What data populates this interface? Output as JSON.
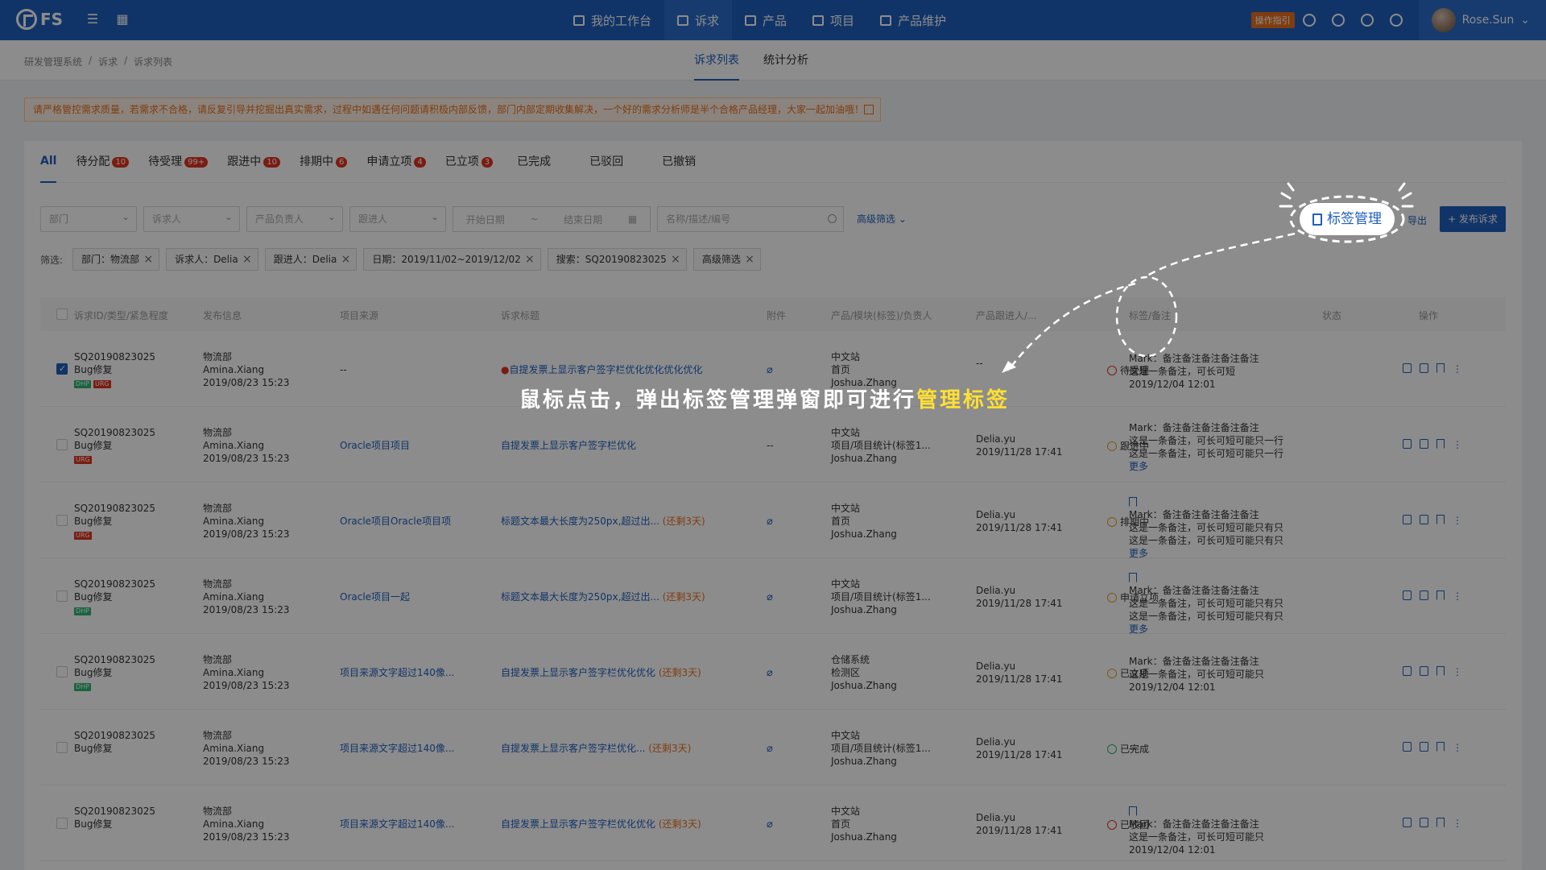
{
  "topbar": {
    "logo_text": "FS",
    "nav": [
      {
        "label": "我的工作台",
        "active": false
      },
      {
        "label": "诉求",
        "active": true
      },
      {
        "label": "产品",
        "active": false
      },
      {
        "label": "项目",
        "active": false
      },
      {
        "label": "产品维护",
        "active": false
      }
    ],
    "guide_badge": "操作指引",
    "user_name": "Rose.Sun"
  },
  "subbar": {
    "breadcrumb": [
      "研发管理系统",
      "/",
      "诉求",
      "/",
      "诉求列表"
    ],
    "tabs": [
      {
        "label": "诉求列表",
        "active": true
      },
      {
        "label": "统计分析",
        "active": false
      }
    ]
  },
  "notice": "请严格管控需求质量，若需求不合格，请反复引导并挖掘出真实需求，过程中如遇任何问题请积极内部反馈，部门内部定期收集解决，一个好的需求分析师是半个合格产品经理，大家一起加油哦！",
  "status_tabs": [
    {
      "label": "All",
      "count": "",
      "active": true
    },
    {
      "label": "待分配",
      "count": "10",
      "active": false
    },
    {
      "label": "待受理",
      "count": "99+",
      "active": false
    },
    {
      "label": "跟进中",
      "count": "10",
      "active": false
    },
    {
      "label": "排期中",
      "count": "6",
      "active": false
    },
    {
      "label": "申请立项",
      "count": "4",
      "active": false
    },
    {
      "label": "已立项",
      "count": "3",
      "active": false
    },
    {
      "label": "已完成",
      "count": "",
      "active": false
    },
    {
      "label": "已驳回",
      "count": "",
      "active": false
    },
    {
      "label": "已撤销",
      "count": "",
      "active": false
    }
  ],
  "filters": {
    "dept": "部门",
    "requester": "诉求人",
    "product_owner": "产品负责人",
    "follower": "跟进人",
    "start_date": "开始日期",
    "date_sep": "~",
    "end_date": "结束日期",
    "search_placeholder": "名称/描述/编号",
    "advanced": "高级筛选",
    "export": "导出",
    "publish": "+ 发布诉求"
  },
  "chips": {
    "label": "筛选:",
    "items": [
      "部门：物流部",
      "诉求人：Delia",
      "跟进人：Delia",
      "日期：2019/11/02~2019/12/02",
      "搜索：SQ20190823025",
      "高级筛选"
    ]
  },
  "table": {
    "headers": [
      "诉求ID/类型/紧急程度",
      "发布信息",
      "项目来源",
      "诉求标题",
      "附件",
      "产品/模块(标签)/负责人",
      "产品跟进人/...",
      "标签/备注",
      "状态",
      "操作"
    ],
    "rows": [
      {
        "id": "SQ20190823025",
        "type": "Bug修复",
        "tags": [
          "DHP",
          "URG"
        ],
        "checked": true,
        "dept": "物流部",
        "user": "Amina.Xiang",
        "time": "2019/08/23 15:23",
        "source": "--",
        "title": "自提发票上显示客户签字栏优化优化优化优化",
        "title_dot": true,
        "remain": "",
        "attach": true,
        "prod": [
          "中文站",
          "首页",
          "Joshua.Zhang"
        ],
        "follow": [
          "--",
          ""
        ],
        "note": [
          "Mark：备注备注备注备注备注",
          "这是一条备注，可长可短",
          "2019/12/04 12:01"
        ],
        "status": "待受理"
      },
      {
        "id": "SQ20190823025",
        "type": "Bug修复",
        "tags": [
          "URG"
        ],
        "checked": false,
        "dept": "物流部",
        "user": "Amina.Xiang",
        "time": "2019/08/23 15:23",
        "source": "Oracle项目项目",
        "title": "自提发票上显示客户签字栏优化",
        "title_dot": false,
        "remain": "",
        "attach": false,
        "prod": [
          "中文站",
          "项目/项目统计(标签1...",
          "Joshua.Zhang"
        ],
        "follow": [
          "Delia.yu",
          "2019/11/28 17:41"
        ],
        "note": [
          "Mark：备注备注备注备注备注",
          "这是一条备注，可长可短可能只一行",
          "这是一条备注，可长可短可能只一行",
          "更多"
        ],
        "status": "跟进中"
      },
      {
        "id": "SQ20190823025",
        "type": "Bug修复",
        "tags": [
          "URG"
        ],
        "checked": false,
        "dept": "物流部",
        "user": "Amina.Xiang",
        "time": "2019/08/23 15:23",
        "source": "Oracle项目Oracle项目项",
        "title": "标题文本最大长度为250px,超过出...",
        "title_dot": false,
        "remain": "(还剩3天)",
        "attach": true,
        "prod": [
          "中文站",
          "首页",
          "Joshua.Zhang"
        ],
        "follow": [
          "Delia.yu",
          "2019/11/28 17:41"
        ],
        "note": [
          "Mark：备注备注备注备注备注",
          "这是一条备注，可长可短可能只有只",
          "这是一条备注，可长可短可能只有只",
          "更多"
        ],
        "status": "排期中"
      },
      {
        "id": "SQ20190823025",
        "type": "Bug修复",
        "tags": [
          "DHP"
        ],
        "checked": false,
        "dept": "物流部",
        "user": "Amina.Xiang",
        "time": "2019/08/23 15:23",
        "source": "Oracle项目一起",
        "title": "标题文本最大长度为250px,超过出...",
        "title_dot": false,
        "remain": "(还剩3天)",
        "attach": true,
        "prod": [
          "中文站",
          "项目/项目统计(标签1...",
          "Joshua.Zhang"
        ],
        "follow": [
          "Delia.yu",
          "2019/11/28 17:41"
        ],
        "note": [
          "Mark：备注备注备注备注备注",
          "这是一条备注，可长可短可能只有只",
          "这是一条备注，可长可短可能只有只",
          "更多"
        ],
        "status": "申请立项"
      },
      {
        "id": "SQ20190823025",
        "type": "Bug修复",
        "tags": [
          "DHP"
        ],
        "checked": false,
        "dept": "物流部",
        "user": "Amina.Xiang",
        "time": "2019/08/23 15:23",
        "source": "项目来源文字超过140像...",
        "title": "自提发票上显示客户签字栏优化优化",
        "title_dot": false,
        "remain": "(还剩3天)",
        "attach": true,
        "prod": [
          "仓储系统",
          "检测区",
          "Joshua.Zhang"
        ],
        "follow": [
          "Delia.yu",
          "2019/11/28 17:41"
        ],
        "note": [
          "Mark：备注备注备注备注备注",
          "这是一条备注，可长可短可能只",
          "2019/12/04 12:01"
        ],
        "status": "已立项"
      },
      {
        "id": "SQ20190823025",
        "type": "Bug修复",
        "tags": [],
        "checked": false,
        "dept": "物流部",
        "user": "Amina.Xiang",
        "time": "2019/08/23 15:23",
        "source": "项目来源文字超过140像...",
        "title": "自提发票上显示客户签字栏优化...",
        "title_dot": false,
        "remain": "(还剩3天)",
        "attach": true,
        "prod": [
          "中文站",
          "项目/项目统计(标签1...",
          "Joshua.Zhang"
        ],
        "follow": [
          "Delia.yu",
          "2019/11/28 17:41"
        ],
        "note": [
          "--"
        ],
        "status": "已完成"
      },
      {
        "id": "SQ20190823025",
        "type": "Bug修复",
        "tags": [],
        "checked": false,
        "dept": "物流部",
        "user": "Amina.Xiang",
        "time": "2019/08/23 15:23",
        "source": "项目来源文字超过140像...",
        "title": "自提发票上显示客户签字栏优化优化",
        "title_dot": false,
        "remain": "(还剩3天)",
        "attach": true,
        "prod": [
          "中文站",
          "首页",
          "Joshua.Zhang"
        ],
        "follow": [
          "Delia.yu",
          "2019/11/28 17:41"
        ],
        "note": [
          "Mark：备注备注备注备注备注",
          "这是一条备注，可长可短可能只",
          "2019/12/04 12:01"
        ],
        "status": "已驳回"
      }
    ]
  },
  "annotation": {
    "tag_manage_button": "标签管理",
    "text_main": "鼠标点击，弹出标签管理弹窗即可进行",
    "text_highlight": "管理标签"
  },
  "colors": {
    "brand": "#1f5fbd",
    "warning": "#e8701e",
    "danger": "#e0341f",
    "success": "#2bb673"
  }
}
